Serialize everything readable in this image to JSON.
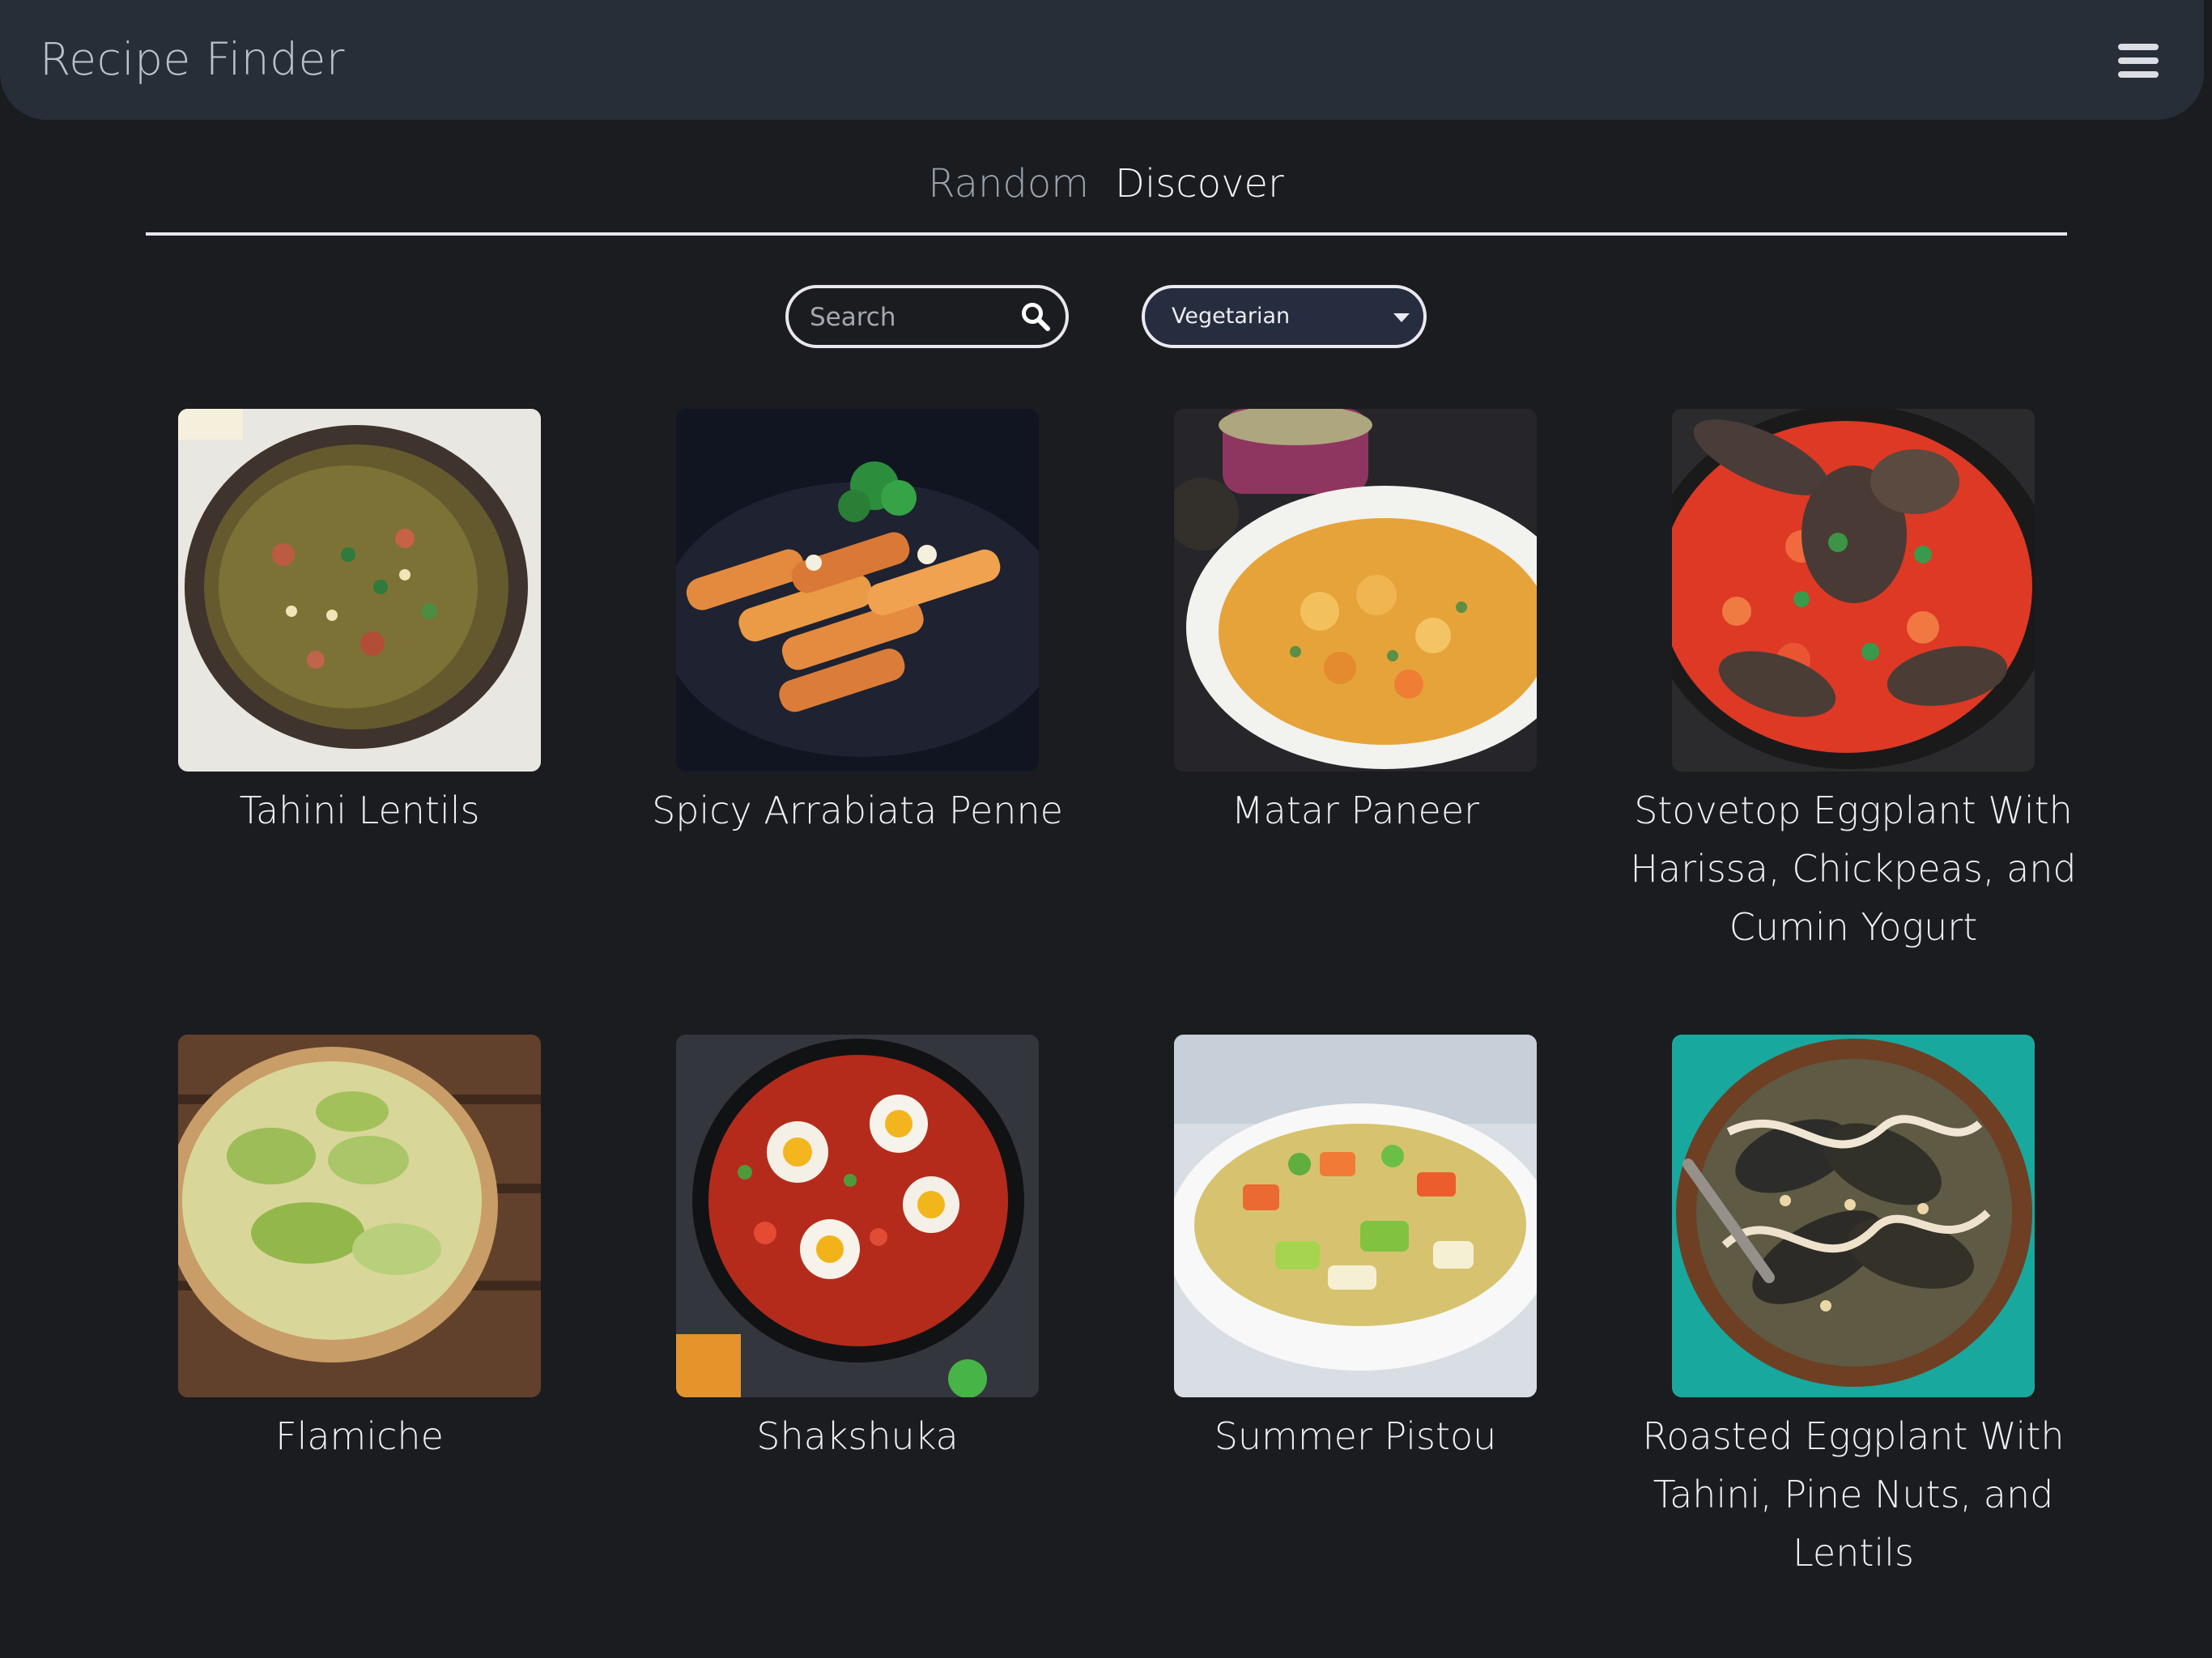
{
  "app": {
    "title": "Recipe Finder"
  },
  "tabs": [
    {
      "label": "Random",
      "active": false
    },
    {
      "label": "Discover",
      "active": true
    }
  ],
  "filters": {
    "search": {
      "placeholder": "Search",
      "value": ""
    },
    "diet": {
      "selected": "Vegetarian"
    }
  },
  "recipes": [
    {
      "title": "Tahini Lentils"
    },
    {
      "title": "Spicy Arrabiata Penne"
    },
    {
      "title": "Matar Paneer"
    },
    {
      "title": "Stovetop Eggplant With Harissa, Chickpeas, and Cumin Yogurt"
    },
    {
      "title": "Flamiche"
    },
    {
      "title": "Shakshuka"
    },
    {
      "title": "Summer Pistou"
    },
    {
      "title": "Roasted Eggplant With Tahini, Pine Nuts, and Lentils"
    }
  ],
  "icons": {
    "menu": "hamburger-menu-icon",
    "search": "search-icon",
    "dropdown": "chevron-down-icon"
  },
  "colors": {
    "background": "#1b1c20",
    "header": "#272e38",
    "text": "#eef0f5",
    "muted_text": "#99a4ae",
    "select_background": "#262d3f"
  }
}
